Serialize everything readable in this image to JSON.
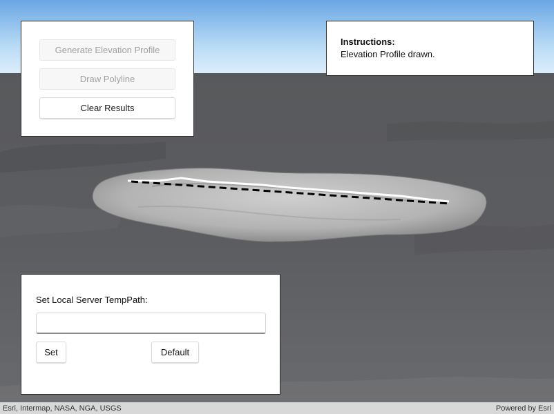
{
  "controls": {
    "generate_label": "Generate Elevation Profile",
    "draw_label": "Draw Polyline",
    "clear_label": "Clear Results"
  },
  "instructions": {
    "title": "Instructions:",
    "text": "Elevation Profile drawn."
  },
  "temp_path": {
    "label": "Set Local Server TempPath:",
    "input_value": "",
    "set_label": "Set",
    "default_label": "Default"
  },
  "attribution": {
    "sources": "Esri, Intermap, NASA, NGA, USGS",
    "powered_by": "Powered by Esri"
  },
  "colors": {
    "sky_top": "#6ea9e6",
    "sky_bottom": "#d9ecfa",
    "terrain": "#5a5b5e",
    "island": "#b9b9b9",
    "profile_line": "#ffffff",
    "polyline": "#000000"
  }
}
